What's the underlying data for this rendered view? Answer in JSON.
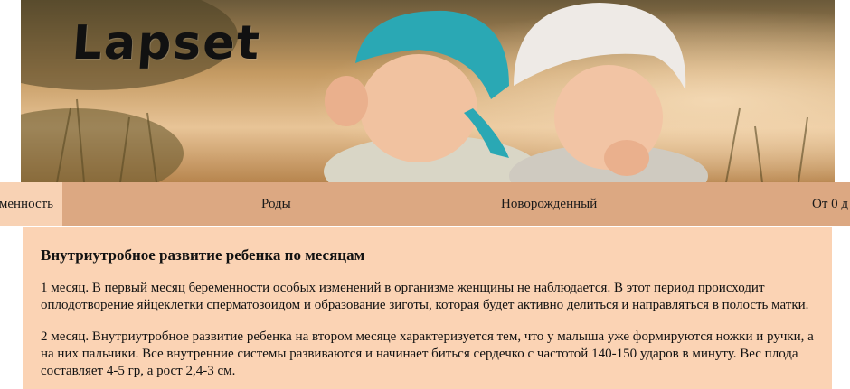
{
  "header": {
    "logo_text": "Lapset",
    "banner_image": "two-babies-in-sun-hats-photo"
  },
  "nav": {
    "items": [
      {
        "label": "Беременность",
        "visible_text": "менность",
        "active": true
      },
      {
        "label": "Роды",
        "active": false
      },
      {
        "label": "Новорожденный",
        "active": false
      },
      {
        "label": "От 0 д",
        "active": false
      }
    ]
  },
  "article": {
    "title": "Внутриутробное развитие ребенка по месяцам",
    "paragraphs": [
      "1 месяц. В первый месяц беременности особых изменений в организме женщины не наблюдается. В этот период происходит оплодотворение яйцеклетки сперматозоидом и образование зиготы, которая будет активно делиться и направляться в полость матки.",
      "2 месяц. Внутриутробное развитие ребенка на втором месяце характеризуется тем, что у малыша уже формируются ножки и ручки, а на них пальчики. Все внутренние системы развиваются и начинает биться сердечко с частотой 140-150 ударов в минуту. Вес плода составляет 4-5 гр, а рост 2,4-3 см."
    ]
  },
  "colors": {
    "nav_bg": "#dca882",
    "nav_active_bg": "#f8d2b4",
    "content_bg": "#fbd3b4"
  }
}
